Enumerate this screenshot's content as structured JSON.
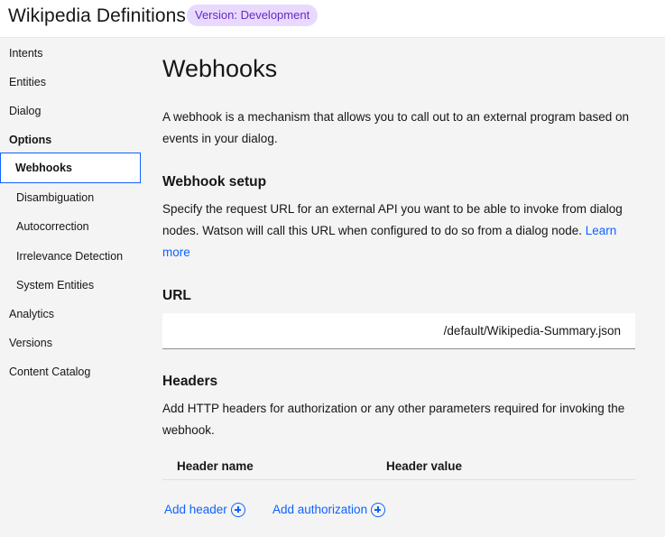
{
  "header": {
    "title": "Wikipedia Definitions",
    "version_tag": "Version: Development"
  },
  "sidebar": {
    "items": [
      {
        "label": "Intents"
      },
      {
        "label": "Entities"
      },
      {
        "label": "Dialog"
      },
      {
        "label": "Options"
      },
      {
        "label": "Webhooks"
      },
      {
        "label": "Disambiguation"
      },
      {
        "label": "Autocorrection"
      },
      {
        "label": "Irrelevance Detection"
      },
      {
        "label": "System Entities"
      },
      {
        "label": "Analytics"
      },
      {
        "label": "Versions"
      },
      {
        "label": "Content Catalog"
      }
    ]
  },
  "main": {
    "title": "Webhooks",
    "intro": "A webhook is a mechanism that allows you to call out to an external program based on events in your dialog.",
    "setup": {
      "heading": "Webhook setup",
      "description": "Specify the request URL for an external API you want to be able to invoke from dialog nodes. Watson will call this URL when configured to do so from a dialog node.",
      "learn_more": "Learn more"
    },
    "url": {
      "heading": "URL",
      "value": "/default/Wikipedia-Summary.json"
    },
    "headers": {
      "heading": "Headers",
      "description": "Add HTTP headers for authorization or any other parameters required for invoking the webhook.",
      "columns": [
        "Header name",
        "Header value"
      ],
      "add_header": "Add header",
      "add_authorization": "Add authorization"
    }
  },
  "colors": {
    "accent": "#0f62fe",
    "tag_bg": "#e8daff",
    "tag_text": "#6929c4"
  }
}
